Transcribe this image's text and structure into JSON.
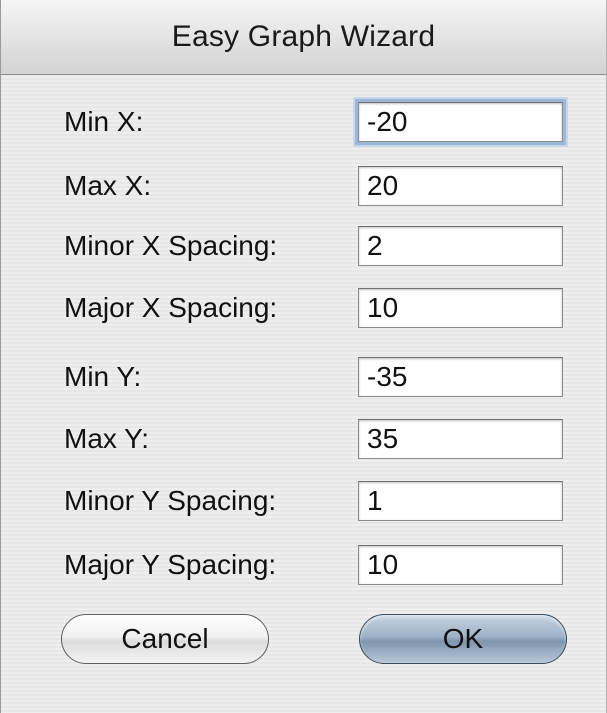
{
  "window": {
    "title": "Easy Graph Wizard"
  },
  "fields": [
    {
      "label": "Min X:",
      "value": "-20",
      "focused": true
    },
    {
      "label": "Max X:",
      "value": "20"
    },
    {
      "label": "Minor X Spacing:",
      "value": "2"
    },
    {
      "label": "Major X Spacing:",
      "value": "10"
    },
    {
      "label": "Min Y:",
      "value": "-35"
    },
    {
      "label": "Max Y:",
      "value": "35"
    },
    {
      "label": "Minor Y Spacing:",
      "value": "1"
    },
    {
      "label": "Major Y Spacing:",
      "value": "10"
    }
  ],
  "buttons": {
    "cancel_label": "Cancel",
    "ok_label": "OK"
  },
  "colors": {
    "focus_ring": "#9bb8d8",
    "default_button": "#9fb2c7"
  }
}
